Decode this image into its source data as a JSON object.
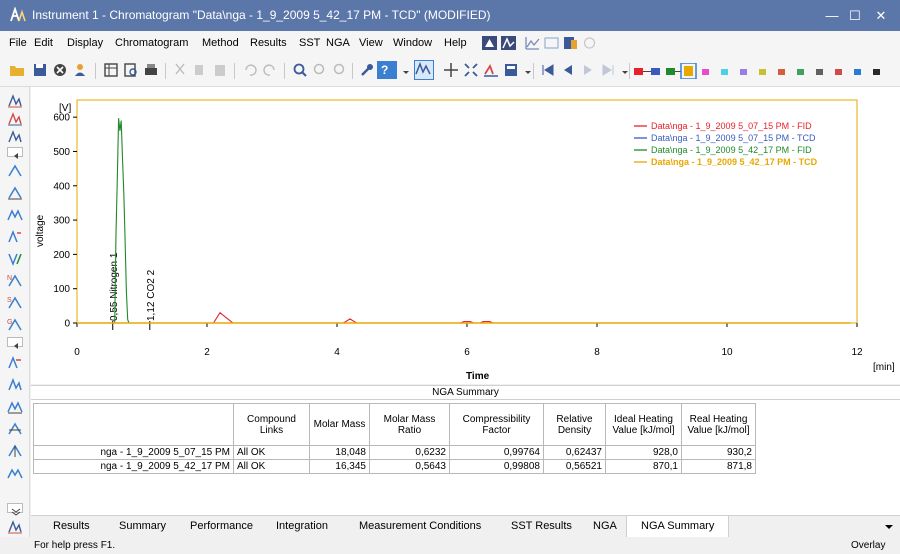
{
  "window": {
    "title": "Instrument 1 - Chromatogram \"Data\\nga - 1_9_2009 5_42_17 PM - TCD\" (MODIFIED)",
    "minimize": "—",
    "maximize": "☐",
    "close": "✕"
  },
  "menu": [
    "File",
    "Edit",
    "Display",
    "Chromatogram",
    "Method",
    "Results",
    "SST",
    "NGA",
    "View",
    "Window",
    "Help"
  ],
  "colors": {
    "titlebar": "#5b77a9",
    "fid_1": "#e8202a",
    "tcd_1": "#3a5bbd",
    "fid_2": "#1e8a2a",
    "tcd_2": "#e8a800"
  },
  "chart_data": {
    "type": "line",
    "ylabel_unit": "[V]",
    "ylabel": "voltage",
    "xlabel": "Time",
    "xunit": "[min]",
    "xlim": [
      0,
      12
    ],
    "ylim": [
      0,
      650
    ],
    "x_ticks": [
      "0",
      "2",
      "4",
      "6",
      "8",
      "10",
      "12"
    ],
    "y_ticks": [
      "0",
      "100",
      "200",
      "300",
      "400",
      "500",
      "600"
    ],
    "legend_position": "top-right",
    "series": [
      {
        "name": "Data\\nga - 1_9_2009 5_07_15 PM - FID",
        "color": "#e8202a",
        "points": [
          [
            0,
            0
          ],
          [
            2.1,
            0
          ],
          [
            2.2,
            30
          ],
          [
            2.3,
            15
          ],
          [
            2.4,
            0
          ],
          [
            4.1,
            0
          ],
          [
            4.2,
            12
          ],
          [
            4.3,
            0
          ],
          [
            5.9,
            0
          ],
          [
            5.95,
            4
          ],
          [
            6.05,
            4
          ],
          [
            6.1,
            0
          ],
          [
            6.2,
            0
          ],
          [
            6.25,
            4
          ],
          [
            6.35,
            4
          ],
          [
            6.4,
            0
          ],
          [
            11.9,
            0
          ]
        ]
      },
      {
        "name": "Data\\nga - 1_9_2009 5_07_15 PM - TCD",
        "color": "#3a5bbd",
        "points": [
          [
            0,
            0
          ],
          [
            11.9,
            0
          ]
        ]
      },
      {
        "name": "Data\\nga - 1_9_2009 5_42_17 PM - FID",
        "color": "#1e8a2a",
        "points": [
          [
            0,
            0
          ],
          [
            0.58,
            0
          ],
          [
            0.6,
            260
          ],
          [
            0.62,
            420
          ],
          [
            0.64,
            597
          ],
          [
            0.66,
            560
          ],
          [
            0.68,
            590
          ],
          [
            0.7,
            480
          ],
          [
            0.72,
            380
          ],
          [
            0.74,
            240
          ],
          [
            0.76,
            90
          ],
          [
            0.78,
            10
          ],
          [
            0.8,
            0
          ],
          [
            11.9,
            0
          ]
        ]
      },
      {
        "name": "Data\\nga - 1_9_2009 5_42_17 PM - TCD",
        "color": "#e8a800",
        "points": [
          [
            0,
            0
          ],
          [
            11.9,
            0
          ]
        ]
      }
    ],
    "annotations": [
      {
        "x": 0.55,
        "label": "0,55 Nitrogen  1"
      },
      {
        "x": 1.12,
        "label": "1,12 CO2  2"
      }
    ]
  },
  "nga_table": {
    "title": "NGA Summary",
    "headers": [
      "Compound Links",
      "Molar Mass",
      "Molar Mass Ratio",
      "Compressibility Factor",
      "Relative Density",
      "Ideal Heating Value [kJ/mol]",
      "Real Heating Value [kJ/mol]"
    ],
    "rows": [
      {
        "name": "nga - 1_9_2009 5_07_15 PM",
        "values": [
          "All OK",
          "18,048",
          "0,6232",
          "0,99764",
          "0,62437",
          "928,0",
          "930,2"
        ]
      },
      {
        "name": "nga - 1_9_2009 5_42_17 PM",
        "values": [
          "All OK",
          "16,345",
          "0,5643",
          "0,99808",
          "0,56521",
          "870,1",
          "871,8"
        ]
      }
    ]
  },
  "tabs": [
    "Results",
    "Summary",
    "Performance",
    "Integration",
    "Measurement Conditions",
    "SST Results",
    "NGA",
    "NGA Summary"
  ],
  "active_tab": "NGA Summary",
  "status": {
    "help": "For help press F1.",
    "mode": "Overlay"
  },
  "palette": [
    "#e8202a",
    "#3a5bbd",
    "#1e8a2a",
    "#e8a800",
    "#e84bd0",
    "#4bd0e8",
    "#9b7be8",
    "#c8c030",
    "#d06040",
    "#40a060",
    "#606060",
    "#d04a4a",
    "#2a7bd0",
    "#2a2a2a"
  ]
}
